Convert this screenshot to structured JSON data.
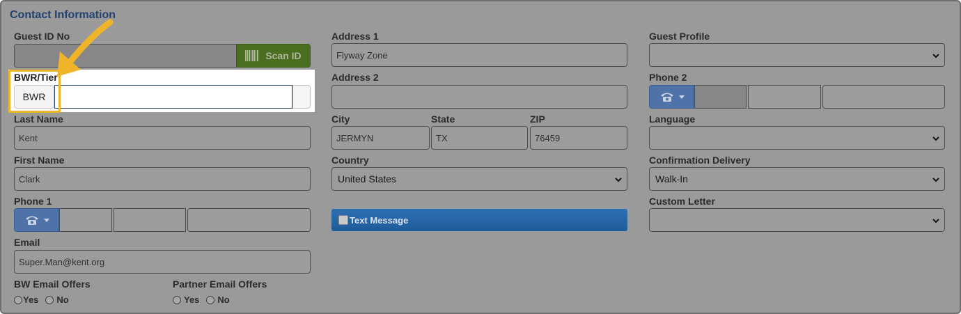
{
  "section_title": "Contact Information",
  "guest_id": {
    "label": "Guest ID No",
    "value": "",
    "scan_label": "Scan ID"
  },
  "bwr": {
    "label": "BWR/Tier",
    "button_label": "BWR",
    "value": ""
  },
  "last_name": {
    "label": "Last Name",
    "value": "Kent"
  },
  "first_name": {
    "label": "First Name",
    "value": "Clark"
  },
  "phone1": {
    "label": "Phone 1",
    "values": [
      "",
      "",
      ""
    ]
  },
  "email": {
    "label": "Email",
    "value": "Super.Man@kent.org"
  },
  "bw_email_offers": {
    "label": "BW Email Offers",
    "options": [
      "Yes",
      "No"
    ]
  },
  "partner_email_offers": {
    "label": "Partner Email Offers",
    "options": [
      "Yes",
      "No"
    ]
  },
  "address1": {
    "label": "Address 1",
    "value": "Flyway Zone"
  },
  "address2": {
    "label": "Address 2",
    "value": ""
  },
  "city": {
    "label": "City",
    "value": "JERMYN"
  },
  "state": {
    "label": "State",
    "value": "TX"
  },
  "zip": {
    "label": "ZIP",
    "value": "76459"
  },
  "country": {
    "label": "Country",
    "value": "United States"
  },
  "text_message": {
    "label": "Text Message"
  },
  "guest_profile": {
    "label": "Guest Profile",
    "value": ""
  },
  "phone2": {
    "label": "Phone 2",
    "values": [
      "",
      "",
      ""
    ]
  },
  "language": {
    "label": "Language",
    "value": ""
  },
  "confirmation_delivery": {
    "label": "Confirmation Delivery",
    "value": "Walk-In"
  },
  "custom_letter": {
    "label": "Custom Letter",
    "value": ""
  },
  "colors": {
    "highlight": "#f0b429",
    "scan_button": "#4a6d1f",
    "text_message": "#1f5b99",
    "phone_button": "#4f73a8"
  }
}
